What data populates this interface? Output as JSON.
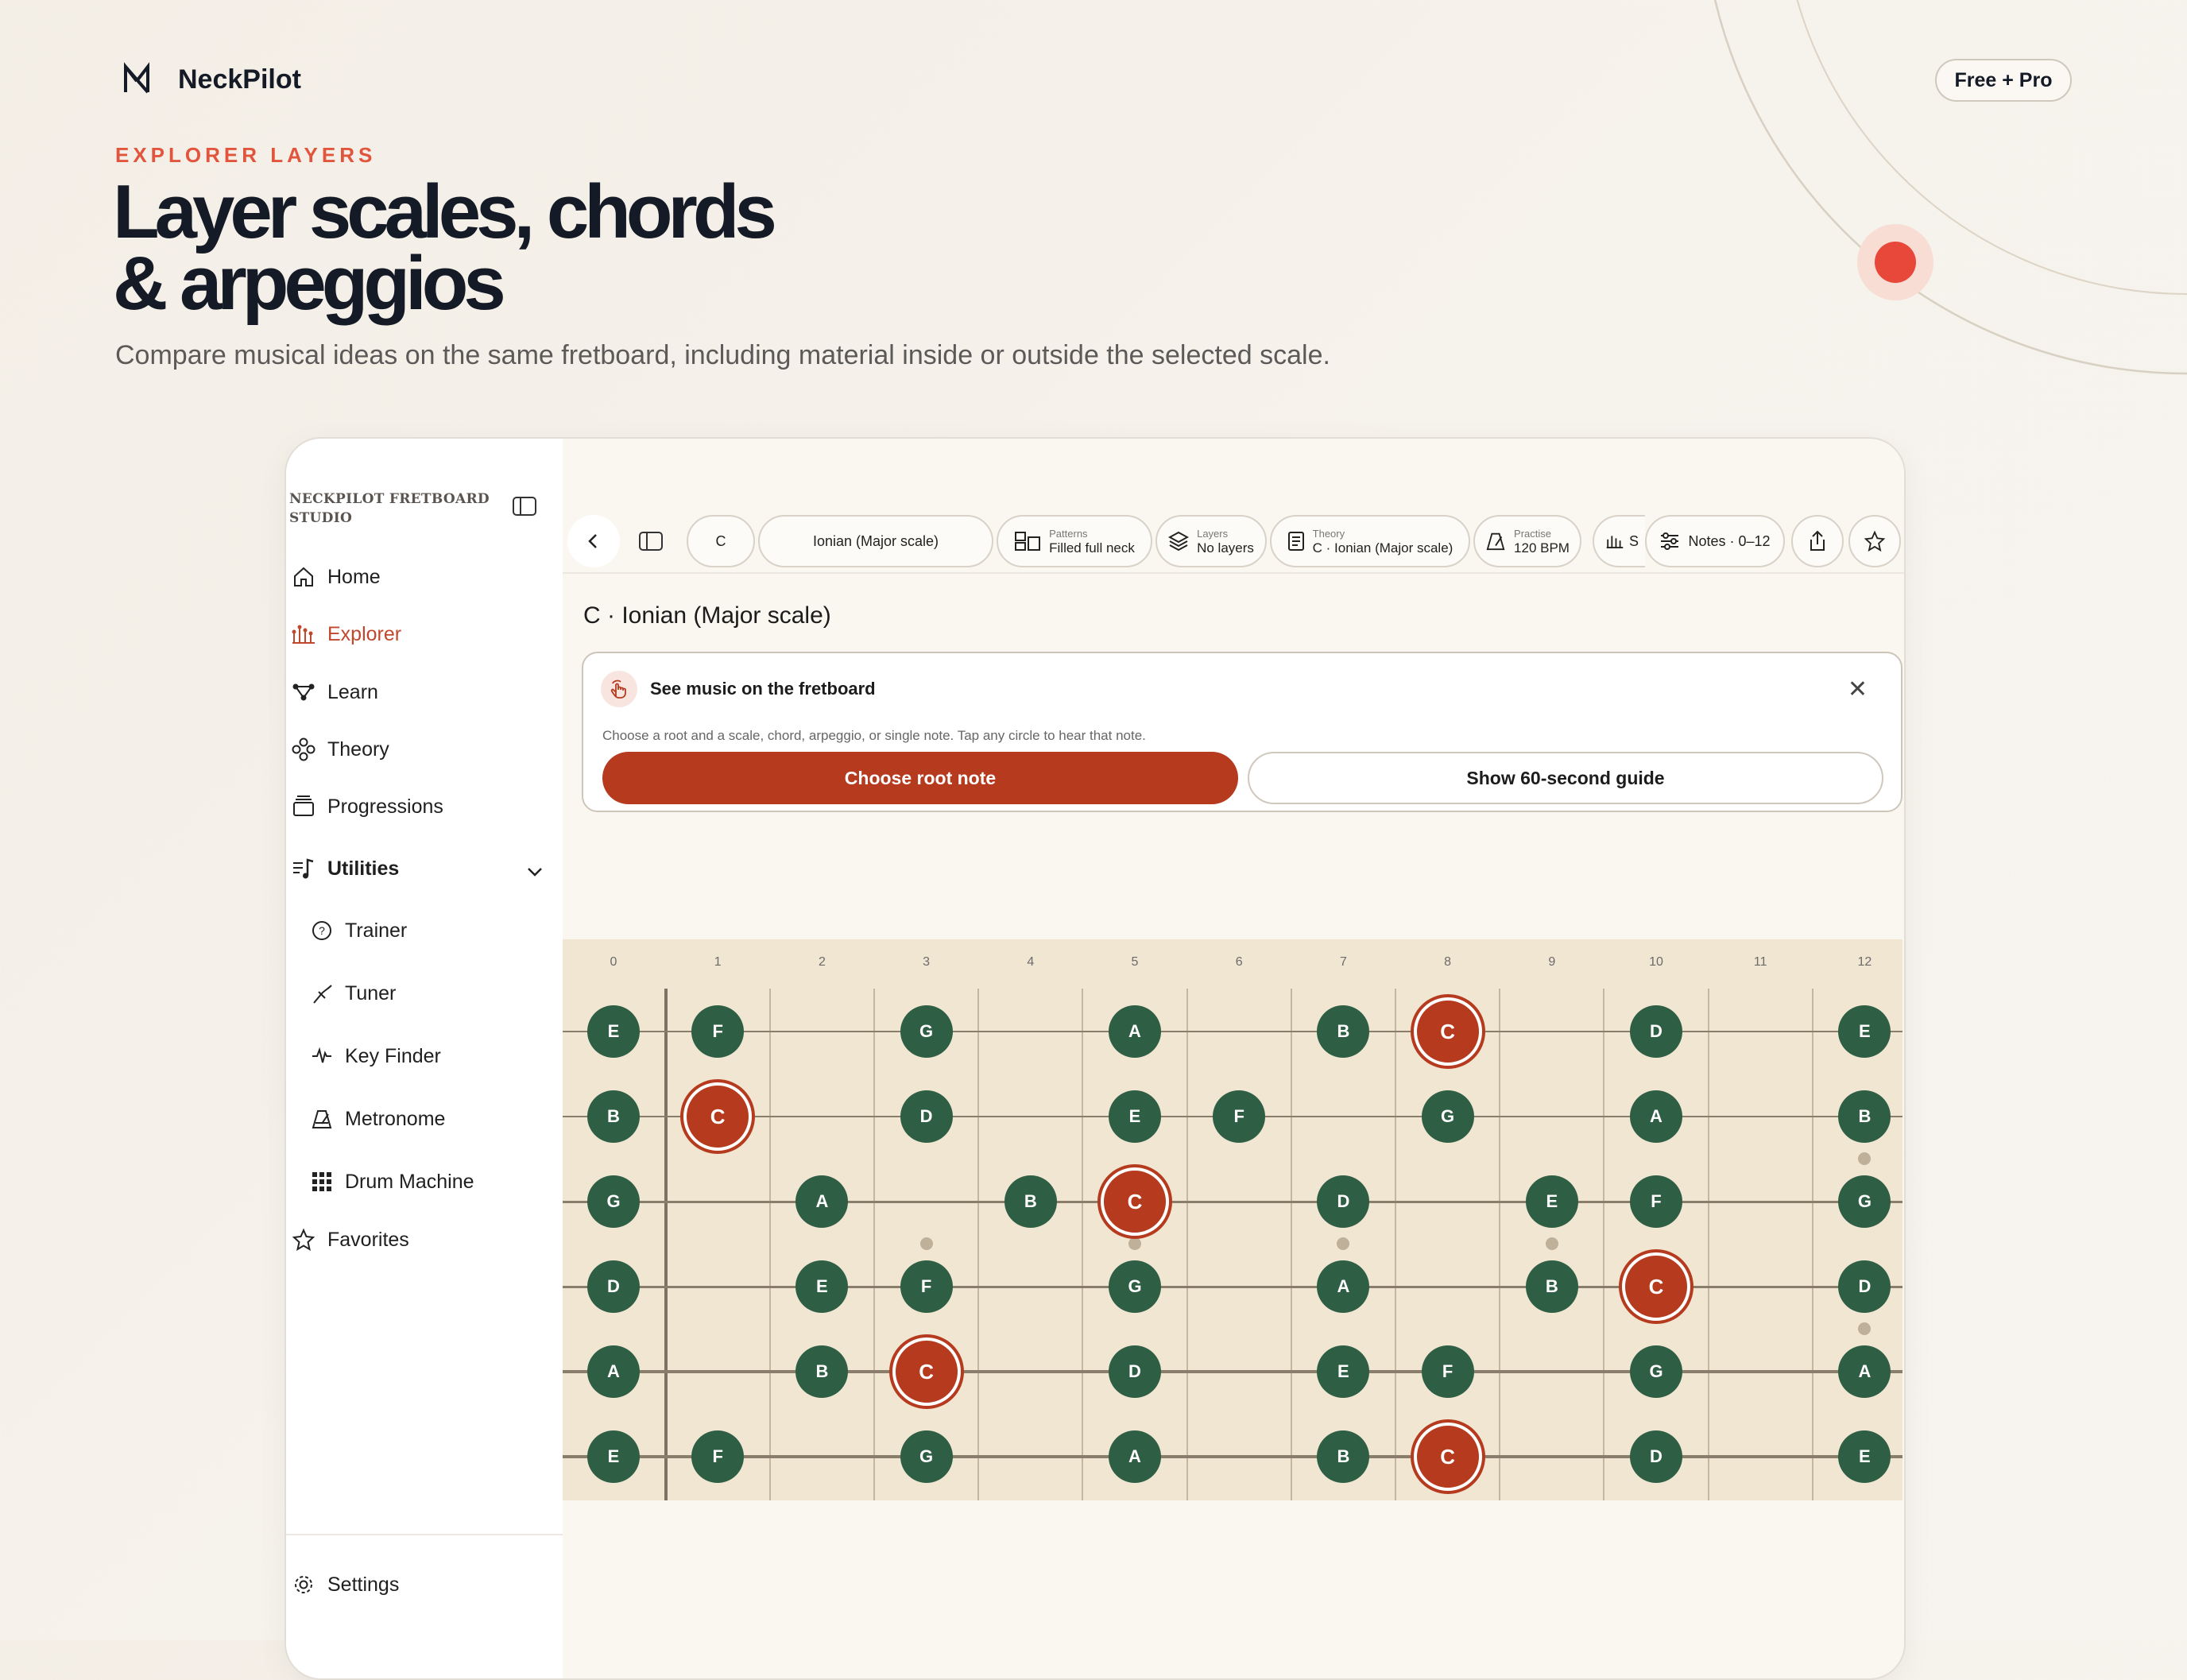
{
  "brand": {
    "name": "NeckPilot",
    "badge": "Free + Pro"
  },
  "hero": {
    "eyebrow": "EXPLORER LAYERS",
    "headline_line1": "Layer scales, chords",
    "headline_line2": "& arpeggios",
    "subline": "Compare musical ideas on the same fretboard, including material inside or outside the selected scale."
  },
  "colors": {
    "accent": "#e2553d",
    "root": "#b53a1e",
    "note": "#2e5e44",
    "board": "#f0e6d2"
  },
  "sidebar": {
    "studio_title": "NECKPILOT FRETBOARD STUDIO",
    "items": [
      {
        "label": "Home",
        "icon": "home-icon"
      },
      {
        "label": "Explorer",
        "icon": "explorer-icon",
        "active": true
      },
      {
        "label": "Learn",
        "icon": "learn-icon"
      },
      {
        "label": "Theory",
        "icon": "theory-icon"
      },
      {
        "label": "Progressions",
        "icon": "progressions-icon"
      }
    ],
    "utilities_label": "Utilities",
    "utilities": [
      {
        "label": "Trainer",
        "icon": "question-icon"
      },
      {
        "label": "Tuner",
        "icon": "tuner-icon"
      },
      {
        "label": "Key Finder",
        "icon": "waveform-icon"
      },
      {
        "label": "Metronome",
        "icon": "metronome-icon"
      },
      {
        "label": "Drum Machine",
        "icon": "grid-icon"
      }
    ],
    "favorites_label": "Favorites",
    "settings_label": "Settings"
  },
  "toolbar": {
    "root": "C",
    "scale": "Ionian (Major scale)",
    "patterns_label": "Patterns",
    "patterns_value": "Filled full neck",
    "layers_label": "Layers",
    "layers_value": "No layers",
    "theory_label": "Theory",
    "theory_value": "C · Ionian (Major scale)",
    "practise_label": "Practise",
    "practise_value": "120 BPM",
    "partial_label": "S",
    "notes_range": "Notes · 0–12"
  },
  "page_title": "C · Ionian (Major scale)",
  "card": {
    "title": "See music on the fretboard",
    "description": "Choose a root and a scale, chord, arpeggio, or single note. Tap any circle to hear that note.",
    "primary": "Choose root note",
    "secondary": "Show 60-second guide"
  },
  "fretboard": {
    "frets": [
      "0",
      "1",
      "2",
      "3",
      "4",
      "5",
      "6",
      "7",
      "8",
      "9",
      "10",
      "11",
      "12"
    ],
    "root": "C",
    "strings": [
      {
        "notes": [
          [
            "0",
            "E"
          ],
          [
            "1",
            "F"
          ],
          [
            "3",
            "G"
          ],
          [
            "5",
            "A"
          ],
          [
            "7",
            "B"
          ],
          [
            "8",
            "C"
          ],
          [
            "10",
            "D"
          ],
          [
            "12",
            "E"
          ]
        ]
      },
      {
        "notes": [
          [
            "0",
            "B"
          ],
          [
            "1",
            "C"
          ],
          [
            "3",
            "D"
          ],
          [
            "5",
            "E"
          ],
          [
            "6",
            "F"
          ],
          [
            "8",
            "G"
          ],
          [
            "10",
            "A"
          ],
          [
            "12",
            "B"
          ]
        ]
      },
      {
        "notes": [
          [
            "0",
            "G"
          ],
          [
            "2",
            "A"
          ],
          [
            "4",
            "B"
          ],
          [
            "5",
            "C"
          ],
          [
            "7",
            "D"
          ],
          [
            "9",
            "E"
          ],
          [
            "10",
            "F"
          ],
          [
            "12",
            "G"
          ]
        ]
      },
      {
        "notes": [
          [
            "0",
            "D"
          ],
          [
            "2",
            "E"
          ],
          [
            "3",
            "F"
          ],
          [
            "5",
            "G"
          ],
          [
            "7",
            "A"
          ],
          [
            "9",
            "B"
          ],
          [
            "10",
            "C"
          ],
          [
            "12",
            "D"
          ]
        ]
      },
      {
        "notes": [
          [
            "0",
            "A"
          ],
          [
            "2",
            "B"
          ],
          [
            "3",
            "C"
          ],
          [
            "5",
            "D"
          ],
          [
            "7",
            "E"
          ],
          [
            "8",
            "F"
          ],
          [
            "10",
            "G"
          ],
          [
            "12",
            "A"
          ]
        ]
      },
      {
        "notes": [
          [
            "0",
            "E"
          ],
          [
            "1",
            "F"
          ],
          [
            "3",
            "G"
          ],
          [
            "5",
            "A"
          ],
          [
            "7",
            "B"
          ],
          [
            "8",
            "C"
          ],
          [
            "10",
            "D"
          ],
          [
            "12",
            "E"
          ]
        ]
      }
    ]
  }
}
